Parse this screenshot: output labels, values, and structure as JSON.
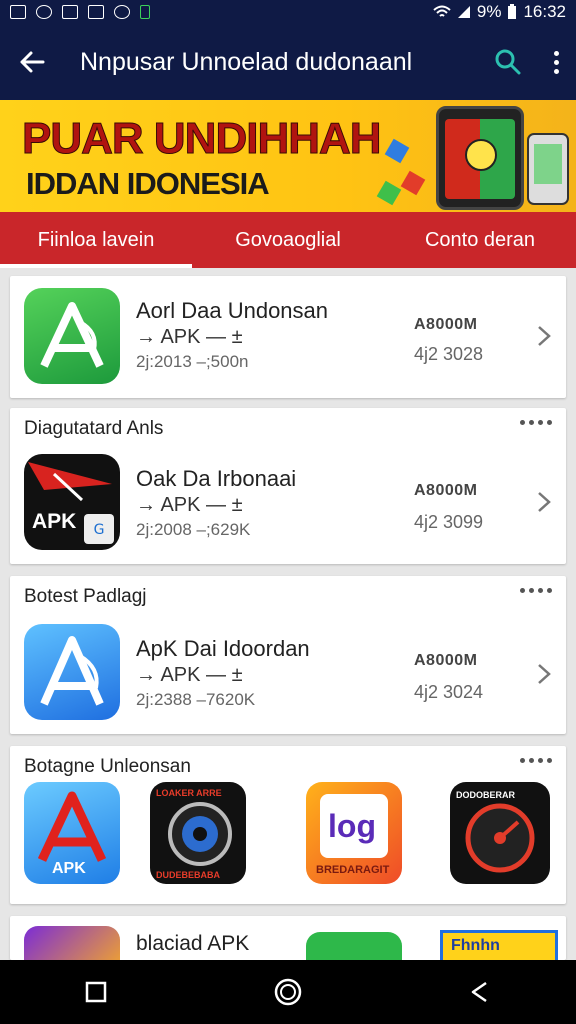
{
  "status_bar": {
    "time": "16:32",
    "battery": "9%",
    "icons": [
      "gallery-icon",
      "app-icon",
      "gmail-icon",
      "mail-icon",
      "messenger-icon",
      "battery-saver-icon",
      "wifi-icon",
      "signal-icon",
      "battery-icon"
    ]
  },
  "app_bar": {
    "title": "Nnpusar Unnoelad dudonaanl",
    "icons": [
      "back-arrow-icon",
      "search-icon",
      "more-vert-icon"
    ]
  },
  "banner": {
    "line1": "PUAR UNDIHHAH",
    "line2": "IDDAN IDONESIA"
  },
  "tabs": [
    {
      "label": "Fiinloa lavein",
      "active": true
    },
    {
      "label": "Govoaoglial",
      "active": false
    },
    {
      "label": "Conto deran",
      "active": false
    }
  ],
  "featured": {
    "name": "Aorl Daa Undonsan",
    "type": "APK",
    "meta": "2j:2013 –;500n",
    "size": "A8000M",
    "count": "4j2 3028"
  },
  "sections": [
    {
      "title": "Diagutatard Anls",
      "app": {
        "name": "Oak Da Irbonaai",
        "type": "APK",
        "icon_text": "APK",
        "meta": "2j:2008 –;629K",
        "size": "A8000M",
        "count": "4j2 3099"
      }
    },
    {
      "title": "Botest Padlagj",
      "app": {
        "name": "ApK Dai Idoordan",
        "type": "APK",
        "meta": "2j:2388 –7620K",
        "size": "A8000M",
        "count": "4j2 3024"
      }
    }
  ],
  "gallery": {
    "title": "Botagne Unleonsan",
    "items": [
      {
        "label": "APK"
      },
      {
        "label": "LOAKER ARRE",
        "sub": "DUDEBEBABA"
      },
      {
        "label": "log",
        "sub": "BREDARAGIT"
      },
      {
        "label": "DODOBERAR"
      }
    ]
  },
  "bottom_row": {
    "name": "blaciad APK",
    "icon_text": "Fhnhn"
  },
  "colors": {
    "app_bar": "#0f1a45",
    "banner": "#ffc313",
    "tabs": "#c9262a",
    "accent_search": "#2cc0b0"
  }
}
